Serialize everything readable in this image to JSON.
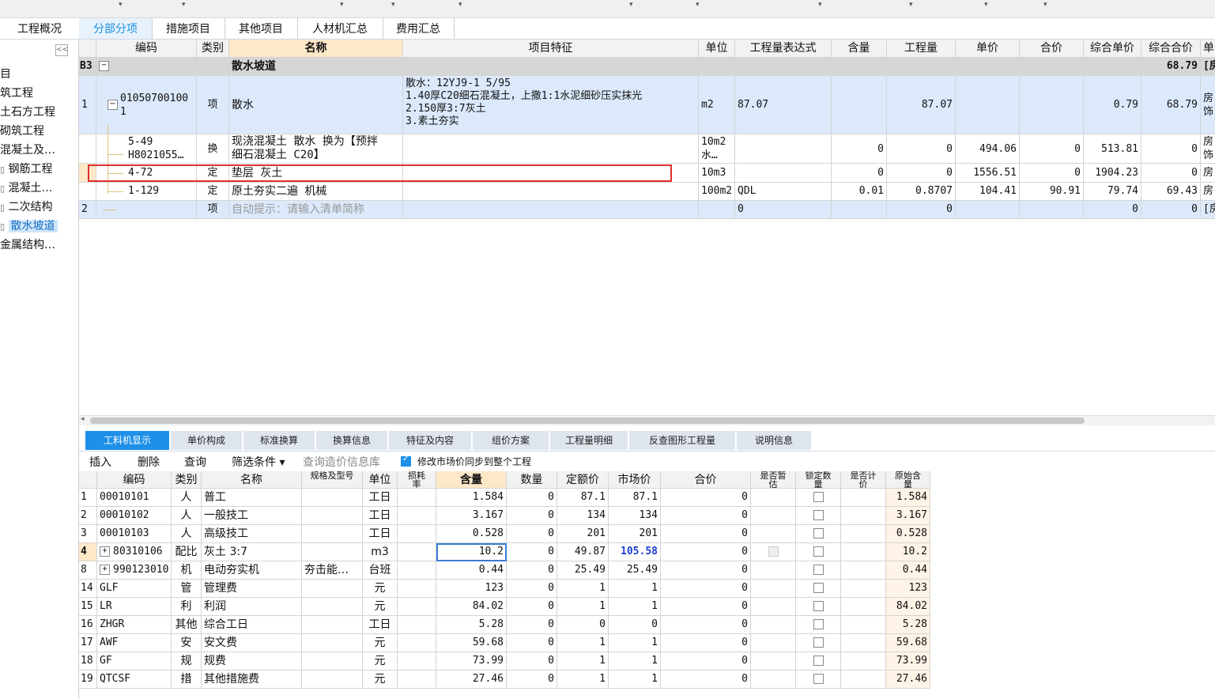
{
  "top_tabs": [
    "工程概况",
    "分部分项",
    "措施项目",
    "其他项目",
    "人材机汇总",
    "费用汇总"
  ],
  "active_top_tab": "分部分项",
  "sidebar": {
    "collapse_label": "<<",
    "items": [
      {
        "label": "目"
      },
      {
        "label": "筑工程"
      },
      {
        "label": "土石方工程"
      },
      {
        "label": "砌筑工程"
      },
      {
        "label": "混凝土及…"
      },
      {
        "label": "钢筋工程"
      },
      {
        "label": "混凝土…"
      },
      {
        "label": "二次结构"
      },
      {
        "label": "散水坡道",
        "selected": true
      },
      {
        "label": "金属结构…"
      }
    ]
  },
  "upper_grid": {
    "columns": [
      "编码",
      "类别",
      "名称",
      "项目特征",
      "单位",
      "工程量表达式",
      "含量",
      "工程量",
      "单价",
      "合价",
      "综合单价",
      "综合合价",
      "单价"
    ],
    "section_row": {
      "code": "B3",
      "name": "散水坡道",
      "total": "68.79",
      "tail": "[房"
    },
    "rows": [
      {
        "num": "1",
        "code1": "01050700100",
        "code2": "1",
        "type": "项",
        "name": "散水",
        "features": [
          "散水：12YJ9-1    5/95",
          "1.40厚C20细石混凝土，上撒1:1水泥细砂压实抹光",
          "2.150厚3:7灰土",
          "3.素土夯实"
        ],
        "unit": "m2",
        "expr": "87.07",
        "content": "",
        "qty": "87.07",
        "price": "",
        "total": "",
        "comp_price": "0.79",
        "comp_total": "68.79",
        "tail1": "房",
        "tail2": "饰"
      },
      {
        "num": "",
        "code1": "5-49",
        "code2": "H8021055…",
        "type": "换",
        "name1": "现浇混凝土 散水  换为【预拌",
        "name2": "细石混凝土 C20】",
        "unit1": "10m2",
        "unit2": "水…",
        "expr": "",
        "content": "0",
        "qty": "0",
        "price": "494.06",
        "total": "0",
        "comp_price": "513.81",
        "comp_total": "0",
        "tail1": "房",
        "tail2": "饰"
      },
      {
        "num": "",
        "code": "4-72",
        "type": "定",
        "name": "垫层 灰土",
        "unit": "10m3",
        "expr": "",
        "content": "0",
        "qty": "0",
        "price": "1556.51",
        "total": "0",
        "comp_price": "1904.23",
        "comp_total": "0",
        "tail": "房"
      },
      {
        "num": "",
        "code": "1-129",
        "type": "定",
        "name": "原土夯实二遍 机械",
        "unit": "100m2",
        "expr": "QDL",
        "content": "0.01",
        "qty": "0.8707",
        "price": "104.41",
        "total": "90.91",
        "comp_price": "79.74",
        "comp_total": "69.43",
        "tail": "房"
      },
      {
        "num": "2",
        "code": "",
        "type": "项",
        "name": "自动提示：请输入清单简称",
        "unit": "",
        "expr": "0",
        "content": "",
        "qty": "0",
        "price": "",
        "total": "",
        "comp_price": "0",
        "comp_total": "0",
        "tail": "[房"
      }
    ]
  },
  "bottom_tabs": [
    "工料机显示",
    "单价构成",
    "标准换算",
    "换算信息",
    "特征及内容",
    "组价方案",
    "工程量明细",
    "反查图形工程量",
    "说明信息"
  ],
  "active_bottom_tab": "工料机显示",
  "toolbar": {
    "insert": "插入",
    "delete": "删除",
    "query": "查询",
    "filter": "筛选条件 ▾",
    "price_db": "查询造价信息库",
    "sync_label": "修改市场价同步到整个工程"
  },
  "lower_grid": {
    "columns": [
      "编码",
      "类别",
      "名称",
      "规格及型号",
      "单位",
      "损耗率",
      "含量",
      "数量",
      "定额价",
      "市场价",
      "合价",
      "是否暂估",
      "锁定数量",
      "是否计价",
      "原始含量"
    ],
    "rows": [
      {
        "n": "1",
        "code": "00010101",
        "type": "人",
        "name": "普工",
        "spec": "",
        "unit": "工日",
        "content": "1.584",
        "qty": "0",
        "base": "87.1",
        "market": "87.1",
        "total": "0",
        "orig": "1.584"
      },
      {
        "n": "2",
        "code": "00010102",
        "type": "人",
        "name": "一般技工",
        "spec": "",
        "unit": "工日",
        "content": "3.167",
        "qty": "0",
        "base": "134",
        "market": "134",
        "total": "0",
        "orig": "3.167"
      },
      {
        "n": "3",
        "code": "00010103",
        "type": "人",
        "name": "高级技工",
        "spec": "",
        "unit": "工日",
        "content": "0.528",
        "qty": "0",
        "base": "201",
        "market": "201",
        "total": "0",
        "orig": "0.528"
      },
      {
        "n": "4",
        "code": "80310106",
        "type": "配比",
        "name": "灰土 3:7",
        "spec": "",
        "unit": "m3",
        "content": "10.2",
        "qty": "0",
        "base": "49.87",
        "market": "105.58",
        "total": "0",
        "orig": "10.2",
        "expand": true,
        "active": true
      },
      {
        "n": "8",
        "code": "990123010",
        "type": "机",
        "name": "电动夯实机",
        "spec": "夯击能…",
        "unit": "台班",
        "content": "0.44",
        "qty": "0",
        "base": "25.49",
        "market": "25.49",
        "total": "0",
        "orig": "0.44",
        "expand": true
      },
      {
        "n": "14",
        "code": "GLF",
        "type": "管",
        "name": "管理费",
        "spec": "",
        "unit": "元",
        "content": "123",
        "qty": "0",
        "base": "1",
        "market": "1",
        "total": "0",
        "orig": "123"
      },
      {
        "n": "15",
        "code": "LR",
        "type": "利",
        "name": "利润",
        "spec": "",
        "unit": "元",
        "content": "84.02",
        "qty": "0",
        "base": "1",
        "market": "1",
        "total": "0",
        "orig": "84.02"
      },
      {
        "n": "16",
        "code": "ZHGR",
        "type": "其他",
        "name": "综合工日",
        "spec": "",
        "unit": "工日",
        "content": "5.28",
        "qty": "0",
        "base": "0",
        "market": "0",
        "total": "0",
        "orig": "5.28"
      },
      {
        "n": "17",
        "code": "AWF",
        "type": "安",
        "name": "安文费",
        "spec": "",
        "unit": "元",
        "content": "59.68",
        "qty": "0",
        "base": "1",
        "market": "1",
        "total": "0",
        "orig": "59.68"
      },
      {
        "n": "18",
        "code": "GF",
        "type": "规",
        "name": "规费",
        "spec": "",
        "unit": "元",
        "content": "73.99",
        "qty": "0",
        "base": "1",
        "market": "1",
        "total": "0",
        "orig": "73.99"
      },
      {
        "n": "19",
        "code": "QTCSF",
        "type": "措",
        "name": "其他措施费",
        "spec": "",
        "unit": "元",
        "content": "27.46",
        "qty": "0",
        "base": "1",
        "market": "1",
        "total": "0",
        "orig": "27.46"
      }
    ]
  },
  "colors": {
    "accent": "#1e90e8",
    "highlight_border": "#e03030",
    "section_bg": "#d6d6d6",
    "selected_row_bg": "#dce9fb",
    "market_blue": "#1a3fd0"
  }
}
